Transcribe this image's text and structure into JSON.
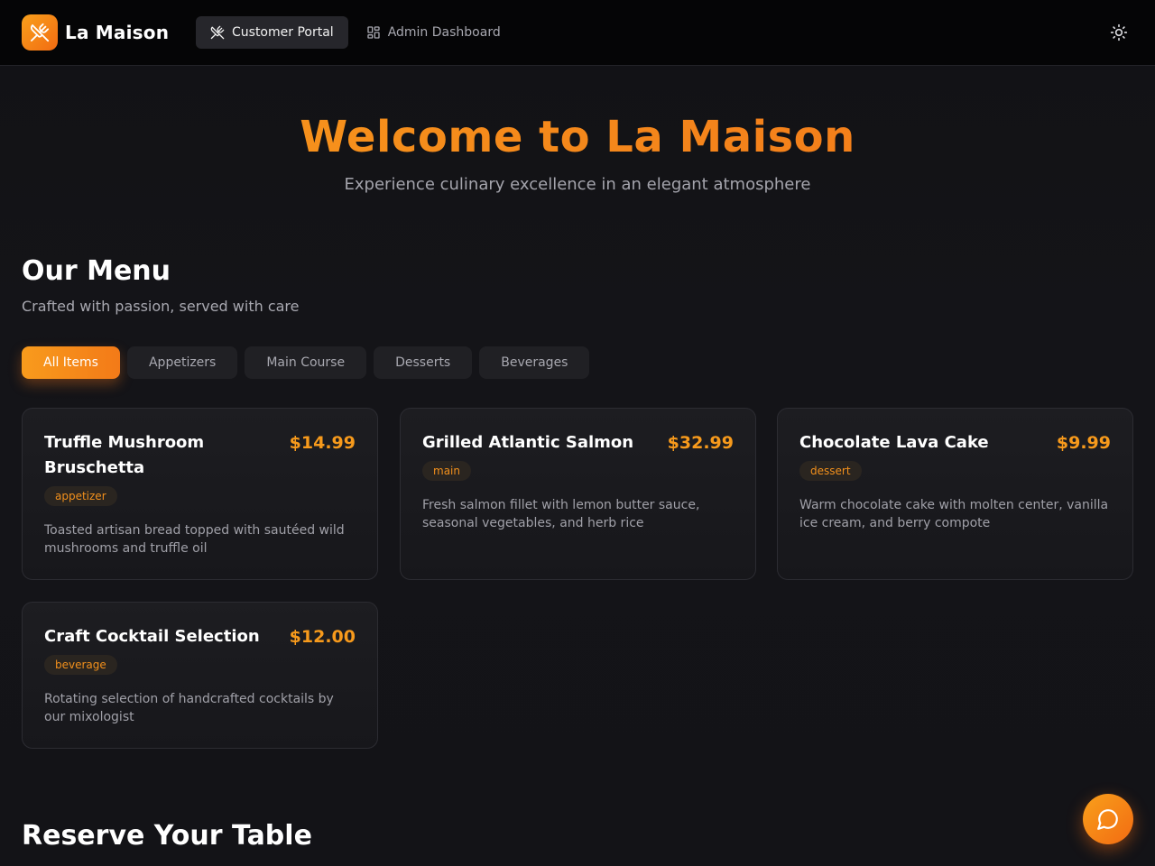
{
  "brand": {
    "name": "La Maison",
    "logo_icon": "utensils-crossed-icon"
  },
  "nav": {
    "items": [
      {
        "label": "Customer Portal",
        "icon": "utensils-crossed-icon",
        "active": true
      },
      {
        "label": "Admin Dashboard",
        "icon": "layout-dashboard-icon",
        "active": false
      }
    ]
  },
  "header": {
    "theme_icon": "sun-icon"
  },
  "hero": {
    "title": "Welcome to La Maison",
    "subtitle": "Experience culinary excellence in an elegant atmosphere"
  },
  "menu": {
    "title": "Our Menu",
    "subtitle": "Crafted with passion, served with care",
    "tabs": [
      {
        "label": "All Items",
        "active": true
      },
      {
        "label": "Appetizers",
        "active": false
      },
      {
        "label": "Main Course",
        "active": false
      },
      {
        "label": "Desserts",
        "active": false
      },
      {
        "label": "Beverages",
        "active": false
      }
    ],
    "items": [
      {
        "name": "Truffle Mushroom Bruschetta",
        "price": "$14.99",
        "category": "appetizer",
        "description": "Toasted artisan bread topped with sautéed wild mushrooms and truffle oil"
      },
      {
        "name": "Grilled Atlantic Salmon",
        "price": "$32.99",
        "category": "main",
        "description": "Fresh salmon fillet with lemon butter sauce, seasonal vegetables, and herb rice"
      },
      {
        "name": "Chocolate Lava Cake",
        "price": "$9.99",
        "category": "dessert",
        "description": "Warm chocolate cake with molten center, vanilla ice cream, and berry compote"
      },
      {
        "name": "Craft Cocktail Selection",
        "price": "$12.00",
        "category": "beverage",
        "description": "Rotating selection of handcrafted cocktails by our mixologist"
      }
    ]
  },
  "reservation": {
    "title": "Reserve Your Table"
  },
  "chat": {
    "icon": "message-circle-icon"
  },
  "colors": {
    "accent": "#f79a1c",
    "accent_dark": "#f26b12",
    "background": "#111114",
    "header": "#050506"
  }
}
